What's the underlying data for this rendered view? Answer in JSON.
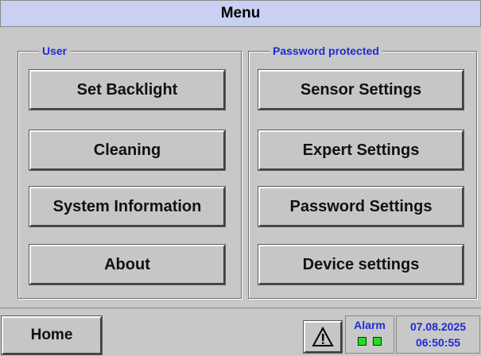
{
  "title": "Menu",
  "groups": {
    "user": {
      "legend": "User",
      "buttons": [
        "Set Backlight",
        "Cleaning",
        "System Information",
        "About"
      ]
    },
    "protected": {
      "legend": "Password protected",
      "buttons": [
        "Sensor Settings",
        "Expert Settings",
        "Password Settings",
        "Device settings"
      ]
    }
  },
  "status": {
    "home_label": "Home",
    "warning_icon": "warning-triangle-icon",
    "alarm_label": "Alarm",
    "date": "07.08.2025",
    "time": "06:50:55"
  },
  "colors": {
    "title_bg": "#c9d0f2",
    "accent_blue": "#1d2bd6",
    "led_green": "#22dd22"
  }
}
